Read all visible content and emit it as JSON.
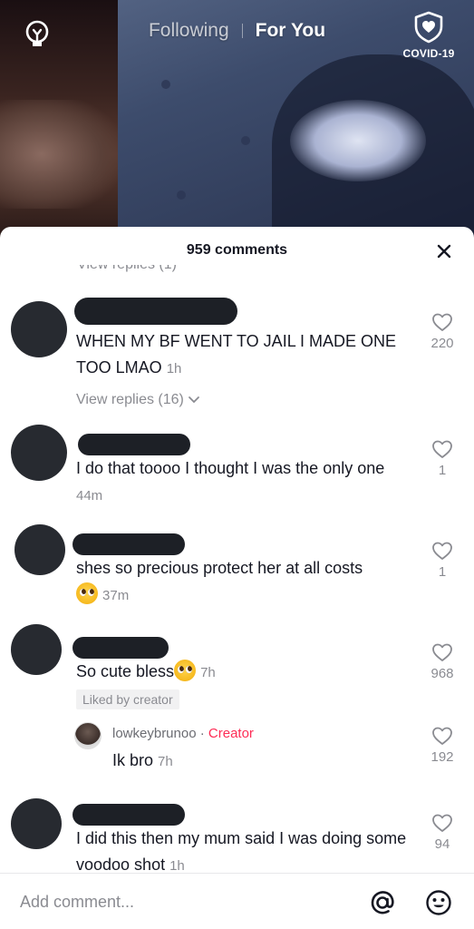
{
  "top_nav": {
    "tabs": [
      "Following",
      "For You"
    ],
    "active_tab": "For You",
    "covid_label": "COVID-19"
  },
  "sheet": {
    "title": "959 comments",
    "clipped_view_replies": "View replies (1)"
  },
  "comments": [
    {
      "text": "WHEN MY BF WENT TO JAIL I MADE ONE TOO LMAO",
      "time": "1h",
      "likes": "220",
      "view_replies": "View replies (16)"
    },
    {
      "text": "I do that toooo I thought I was the only one",
      "time": "44m",
      "likes": "1"
    },
    {
      "text": "shes so precious protect her at all costs",
      "time": "37m",
      "likes": "1"
    },
    {
      "text": "So cute bless",
      "time": "7h",
      "likes": "968",
      "liked_by": "Liked by creator",
      "reply": {
        "username": "lowkeybrunoo",
        "separator": " · ",
        "tag": "Creator",
        "text": "Ik bro",
        "time": "7h",
        "likes": "192"
      }
    },
    {
      "text": "I did this then my mum said I was doing some voodoo shot",
      "time": "1h",
      "likes": "94"
    }
  ],
  "input": {
    "placeholder": "Add comment..."
  },
  "colors": {
    "creator": "#fe2c55",
    "secondary_text": "#8a8b91",
    "primary_text": "#161823"
  }
}
